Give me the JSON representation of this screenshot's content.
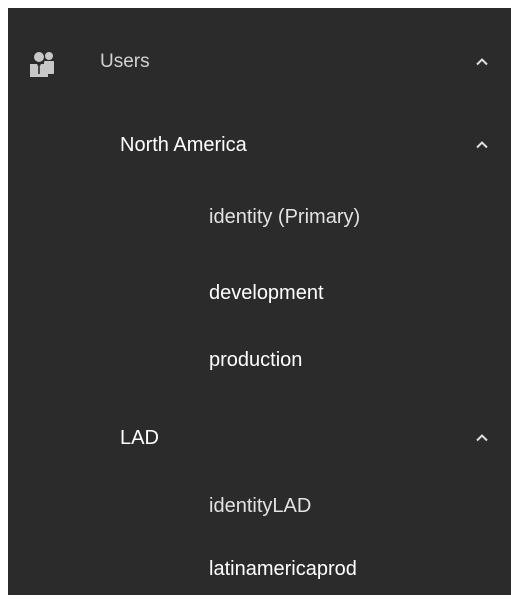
{
  "tree": {
    "users": {
      "label": "Users",
      "icon": "users-icon",
      "expanded": true
    },
    "groups": [
      {
        "label": "North America",
        "expanded": true,
        "items": [
          {
            "label": "identity (Primary)"
          },
          {
            "label": "development"
          },
          {
            "label": "production"
          }
        ]
      },
      {
        "label": "LAD",
        "expanded": true,
        "items": [
          {
            "label": "identityLAD"
          },
          {
            "label": "latinamericaprod"
          }
        ]
      }
    ]
  },
  "colors": {
    "panel_bg": "#2b2b2b",
    "text_primary": "#ffffff",
    "text_secondary": "#d2d2d2",
    "icon_fill": "#c8c8c8"
  }
}
